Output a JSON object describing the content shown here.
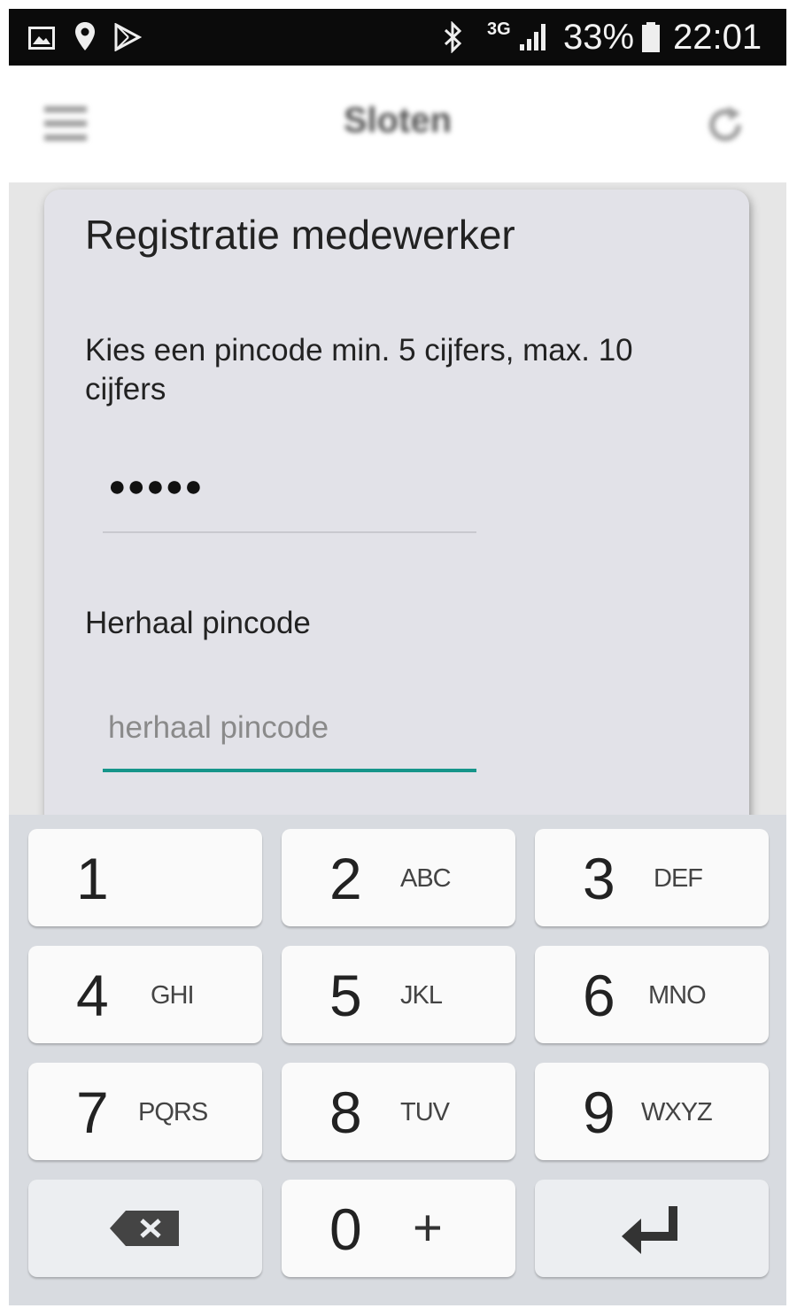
{
  "status_bar": {
    "network": "3G",
    "battery_percent": "33%",
    "time": "22:01",
    "icons": [
      "image-icon",
      "location-pin-icon",
      "play-store-icon",
      "bluetooth-icon",
      "signal-icon",
      "battery-icon"
    ]
  },
  "app_bar": {
    "title": "Sloten",
    "icons": [
      "menu-icon",
      "refresh-icon"
    ]
  },
  "dialog": {
    "title": "Registratie medewerker",
    "message": "Kies een pincode min. 5 cijfers, max. 10 cijfers",
    "pin_value": "●●●●●",
    "repeat_label": "Herhaal pincode",
    "repeat_placeholder": "herhaal pincode",
    "repeat_value": ""
  },
  "keyboard": {
    "keys": [
      {
        "digit": "1",
        "letters": ""
      },
      {
        "digit": "2",
        "letters": "ABC"
      },
      {
        "digit": "3",
        "letters": "DEF"
      },
      {
        "digit": "4",
        "letters": "GHI"
      },
      {
        "digit": "5",
        "letters": "JKL"
      },
      {
        "digit": "6",
        "letters": "MNO"
      },
      {
        "digit": "7",
        "letters": "PQRS"
      },
      {
        "digit": "8",
        "letters": "TUV"
      },
      {
        "digit": "9",
        "letters": "WXYZ"
      },
      {
        "digit": "0",
        "letters": "+"
      }
    ],
    "function_keys": [
      "backspace-icon",
      "enter-icon"
    ]
  },
  "colors": {
    "accent": "#16958a",
    "dialog_bg": "#e2e2e8",
    "keyboard_bg": "#d8dbe0"
  }
}
